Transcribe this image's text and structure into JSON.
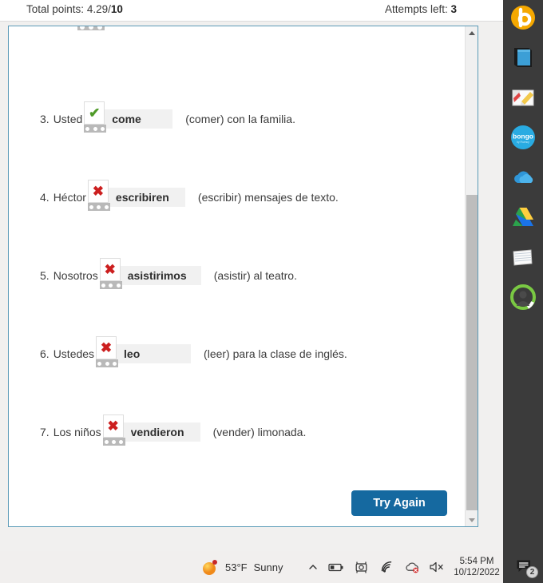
{
  "status": {
    "total_points_label": "Total points:",
    "total_points_value": "4.29",
    "total_points_separator": "/",
    "total_points_max": "10",
    "attempts_label": "Attempts left:",
    "attempts_value": "3"
  },
  "exercise": {
    "questions": [
      {
        "number": "3.",
        "subject": "Usted",
        "answer": "come",
        "status": "correct",
        "marker_glyph": "✔",
        "hint": "(comer) con la familia."
      },
      {
        "number": "4.",
        "subject": "Héctor",
        "answer": "escribiren",
        "status": "incorrect",
        "marker_glyph": "✖",
        "hint": "(escribir) mensajes de texto."
      },
      {
        "number": "5.",
        "subject": "Nosotros",
        "answer": "asistirimos",
        "status": "incorrect",
        "marker_glyph": "✖",
        "hint": "(asistir) al teatro."
      },
      {
        "number": "6.",
        "subject": "Ustedes",
        "answer": "leo",
        "status": "incorrect",
        "marker_glyph": "✖",
        "hint": "(leer) para la clase de inglés."
      },
      {
        "number": "7.",
        "subject": "Los niños",
        "answer": "vendieron",
        "status": "incorrect",
        "marker_glyph": "✖",
        "hint": "(vender) limonada."
      }
    ],
    "try_again_label": "Try Again"
  },
  "dock": {
    "items": [
      {
        "name": "beats-music-icon",
        "label": ""
      },
      {
        "name": "book-icon",
        "label": ""
      },
      {
        "name": "paint-editor-icon",
        "label": ""
      },
      {
        "name": "bongo-icon",
        "label": "bongo"
      },
      {
        "name": "onedrive-cloud-icon",
        "label": ""
      },
      {
        "name": "google-drive-icon",
        "label": ""
      },
      {
        "name": "notes-icon",
        "label": ""
      },
      {
        "name": "user-profile-icon",
        "label": ""
      }
    ]
  },
  "taskbar": {
    "weather_temp": "53°F",
    "weather_condition": "Sunny",
    "time": "5:54 PM",
    "date": "10/12/2022",
    "notification_count": "2"
  },
  "colors": {
    "accent_blue": "#1569a0",
    "panel_border": "#5b9bb8",
    "correct_green": "#4e9a28",
    "incorrect_red": "#cc1f1f",
    "dock_background": "#3b3b3b",
    "field_background": "#f1f1f1"
  }
}
